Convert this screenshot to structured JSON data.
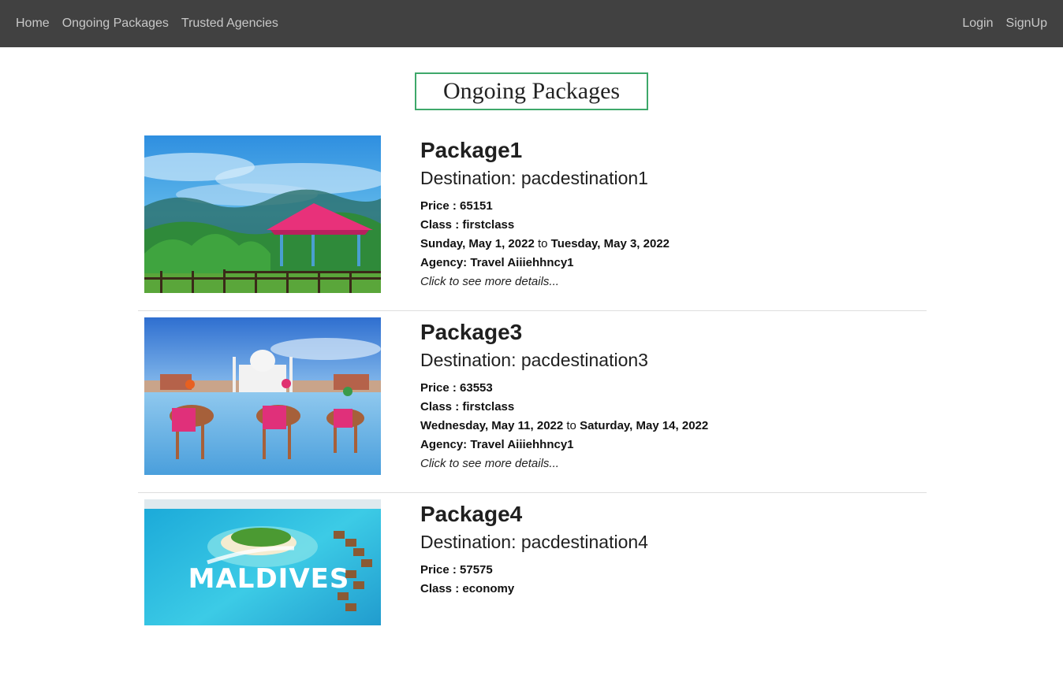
{
  "nav": {
    "left": [
      {
        "label": "Home"
      },
      {
        "label": "Ongoing Packages"
      },
      {
        "label": "Trusted Agencies"
      }
    ],
    "right": [
      {
        "label": "Login"
      },
      {
        "label": "SignUp"
      }
    ]
  },
  "page": {
    "title": "Ongoing Packages"
  },
  "packages": [
    {
      "name": "Package1",
      "destination": "Destination: pacdestination1",
      "price": "Price : 65151",
      "class": "Class : firstclass",
      "start": "Sunday, May 1, 2022",
      "to": "to",
      "end": "Tuesday, May 3, 2022",
      "agency": "Agency: Travel Aiiiehhncy1",
      "more": "Click to see more details..."
    },
    {
      "name": "Package3",
      "destination": "Destination: pacdestination3",
      "price": "Price : 63553",
      "class": "Class : firstclass",
      "start": "Wednesday, May 11, 2022",
      "to": "to",
      "end": "Saturday, May 14, 2022",
      "agency": "Agency: Travel Aiiiehhncy1",
      "more": "Click to see more details..."
    },
    {
      "name": "Package4",
      "destination": "Destination: pacdestination4",
      "price": "Price : 57575",
      "class": "Class : economy",
      "image_text": "MALDIVES"
    }
  ]
}
